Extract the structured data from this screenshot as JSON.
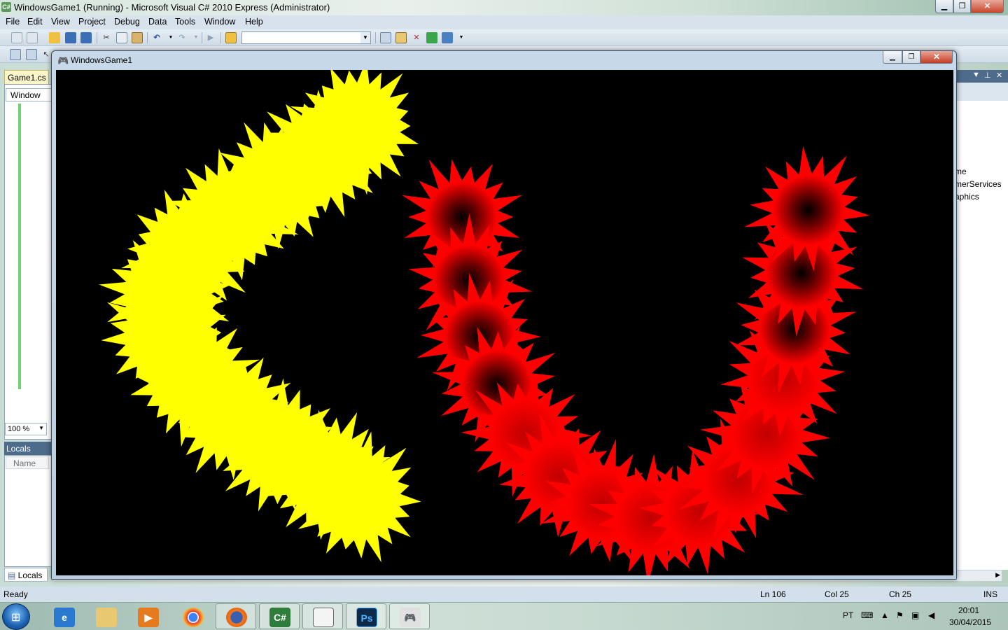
{
  "vs": {
    "title": "WindowsGame1 (Running) - Microsoft Visual C# 2010 Express (Administrator)",
    "app_icon": "C#",
    "menu": [
      "File",
      "Edit",
      "View",
      "Project",
      "Debug",
      "Data",
      "Tools",
      "Window",
      "Help"
    ],
    "toolbar_icons": [
      "new-project-icon",
      "add-item-icon",
      "open-icon",
      "save-icon",
      "save-all-icon",
      "cut-icon",
      "copy-icon",
      "paste-icon",
      "undo-icon",
      "redo-icon",
      "start-debug-icon",
      "find-icon",
      "solution-explorer-icon",
      "properties-icon",
      "toolbox-icon",
      "start-page-icon",
      "extension-icon"
    ],
    "config_combo_value": "",
    "editor_tab": "Game1.cs",
    "class_combo": "Window",
    "zoom": "100 %",
    "locals_title": "Locals",
    "locals_column": "Name",
    "locals_tab": "Locals",
    "right_tree": [
      "me",
      "merServices",
      "aphics"
    ],
    "status": {
      "ready": "Ready",
      "ln": "Ln 106",
      "col": "Col 25",
      "ch": "Ch 25",
      "ins": "INS"
    }
  },
  "game": {
    "title": "WindowsGame1",
    "background": "#000000",
    "shapes": [
      {
        "name": "yellow-c-shape",
        "color": "#ffff00"
      },
      {
        "name": "red-u-shape",
        "color": "#ff0000"
      }
    ]
  },
  "taskbar": {
    "apps": [
      "internet-explorer-icon",
      "file-explorer-icon",
      "media-player-icon",
      "chrome-icon",
      "firefox-icon",
      "visual-csharp-icon",
      "notepad-icon",
      "photoshop-icon",
      "game-controller-icon"
    ],
    "app_labels": [
      "",
      "",
      "",
      "",
      "",
      "C#",
      "",
      "Ps",
      ""
    ],
    "lang": "PT",
    "time": "20:01",
    "date": "30/04/2015"
  }
}
